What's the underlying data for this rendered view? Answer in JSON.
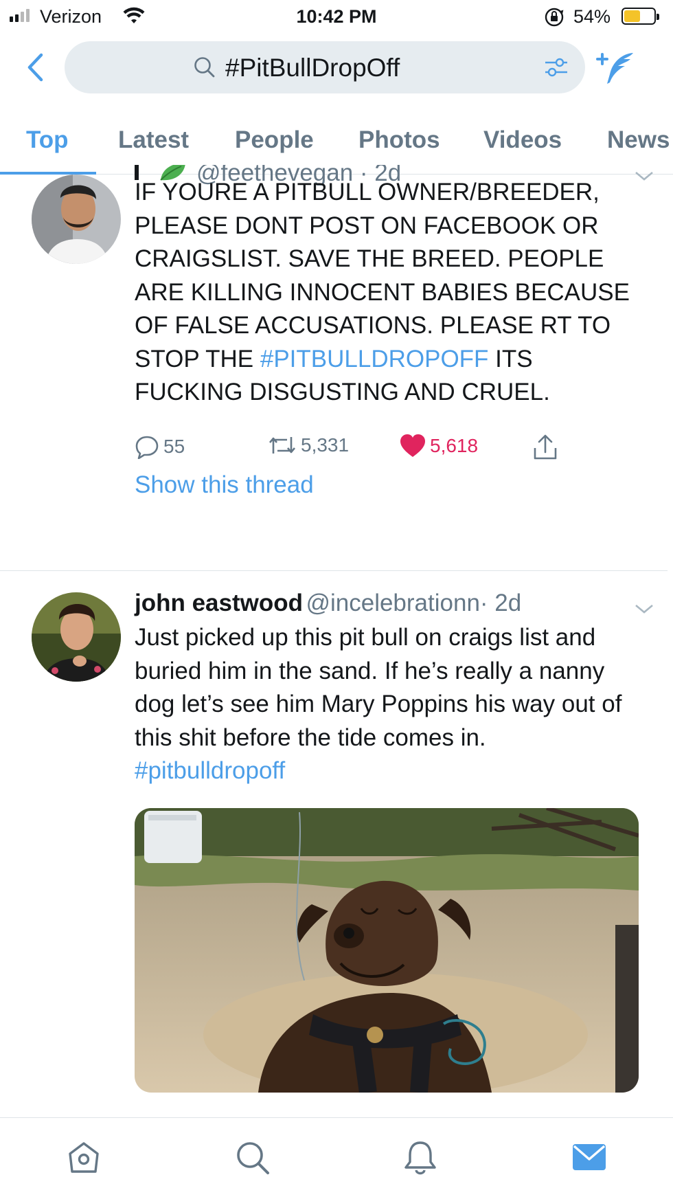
{
  "status_bar": {
    "carrier": "Verizon",
    "time": "10:42 PM",
    "battery_percent": "54%",
    "battery_level": 0.54,
    "signal_bars": 2
  },
  "search": {
    "query": "#PitBullDropOff"
  },
  "tabs": [
    {
      "label": "Top",
      "active": true
    },
    {
      "label": "Latest",
      "active": false
    },
    {
      "label": "People",
      "active": false
    },
    {
      "label": "Photos",
      "active": false
    },
    {
      "label": "Videos",
      "active": false
    },
    {
      "label": "News",
      "active": false
    }
  ],
  "tweets": [
    {
      "handle_partial": "@feethevegan · 2d",
      "text_before": "IF YOURE A PITBULL OWNER/BREEDER, PLEASE DONT POST ON FACEBOOK OR CRAIGSLIST. SAVE THE BREED. PEOPLE ARE KILLING INNOCENT BABIES BECAUSE OF FALSE ACCUSATIONS. PLEASE RT TO STOP THE ",
      "hashtag": "#PITBULLDROPOFF",
      "text_after": " ITS FUCKING DISGUSTING AND CRUEL.",
      "replies": "55",
      "retweets": "5,331",
      "likes": "5,618",
      "liked": true,
      "thread_link": "Show this thread"
    },
    {
      "name": "john eastwood",
      "handle": "@incelebrationn",
      "time": "· 2d",
      "text_before": "Just picked up this pit bull on craigs list and buried him in the sand. If he’s really a nanny dog let’s see him Mary Poppins his way out of this shit before the tide comes in. ",
      "hashtag": "#pitbulldropoff"
    }
  ],
  "colors": {
    "accent": "#4c9ee8",
    "like": "#e0245e",
    "muted": "#657786",
    "search_bg": "#e6ecf0"
  },
  "bottom_nav": [
    {
      "icon": "home-icon",
      "active": false
    },
    {
      "icon": "search-icon",
      "active": false
    },
    {
      "icon": "notifications-icon",
      "active": false
    },
    {
      "icon": "messages-icon",
      "active": true
    }
  ]
}
